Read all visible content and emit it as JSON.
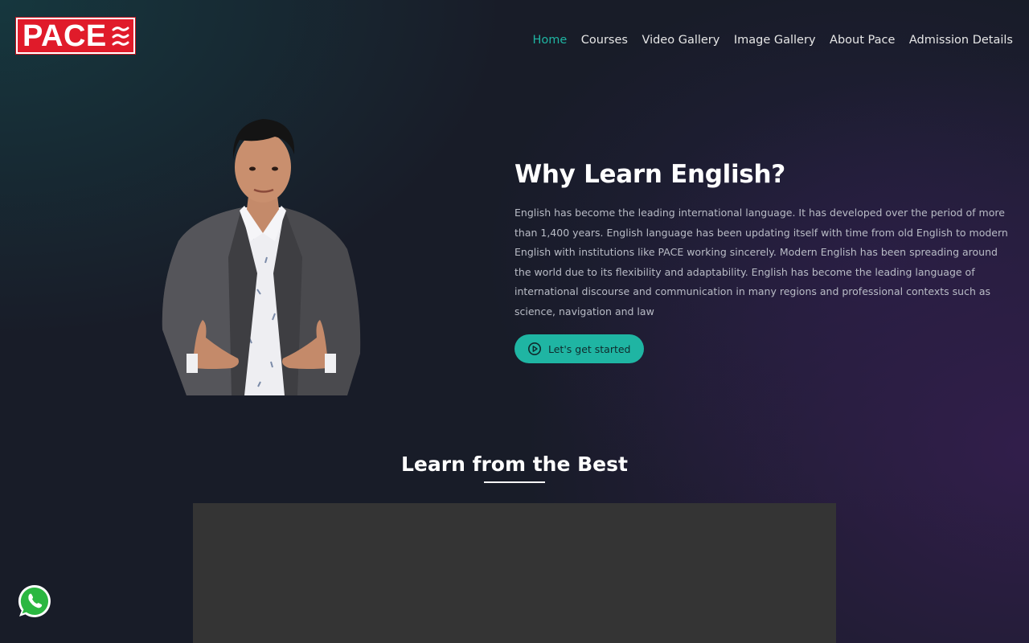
{
  "header": {
    "logo_text": "PACE",
    "nav": [
      {
        "label": "Home",
        "active": true
      },
      {
        "label": "Courses",
        "active": false
      },
      {
        "label": "Video Gallery",
        "active": false
      },
      {
        "label": "Image Gallery",
        "active": false
      },
      {
        "label": "About Pace",
        "active": false
      },
      {
        "label": "Admission Details",
        "active": false
      }
    ]
  },
  "hero": {
    "title": "Why Learn English?",
    "body": "English has become the leading international language. It has developed over the period of more than 1,400 years. English language has been updating itself with time from old English to modern English with institutions like PACE working sincerely. Modern English has been spreading around the world due to its flexibility and adaptability. English has become the leading language of international discourse and communication in many regions and professional contexts such as science, navigation and law",
    "cta_label": "Let's get started",
    "cta_icon": "play-circle-icon",
    "photo": "instructor-photo"
  },
  "section": {
    "title": "Learn from the Best"
  },
  "floating": {
    "whatsapp_icon": "whatsapp-icon"
  },
  "colors": {
    "accent": "#1fb5a3",
    "logo_red": "#e01b2a",
    "video_bg": "#343434"
  }
}
